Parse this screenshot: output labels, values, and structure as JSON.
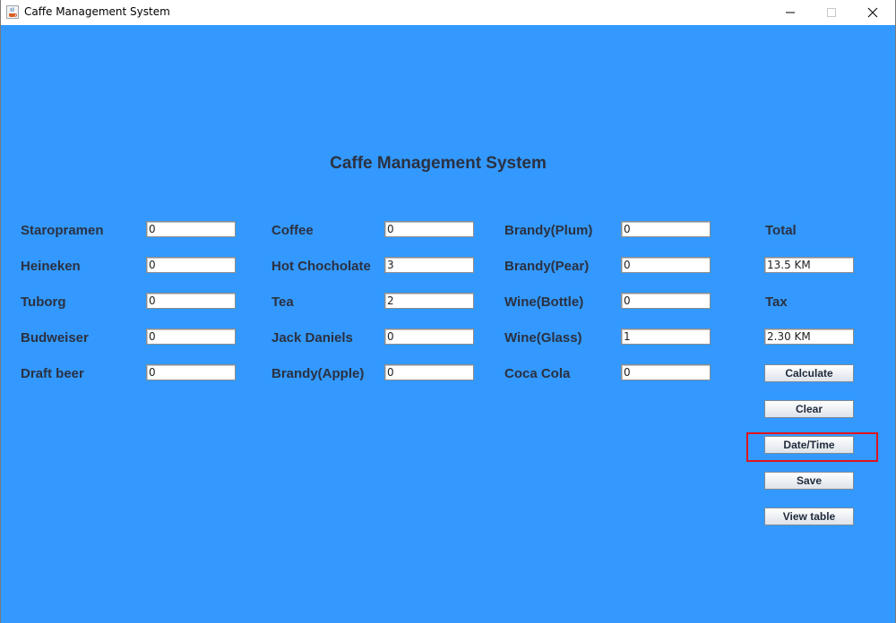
{
  "window": {
    "title": "Caffe Management System"
  },
  "heading": "Caffe Management System",
  "items": [
    {
      "label": "Staropramen",
      "value": "0"
    },
    {
      "label": "Heineken",
      "value": "0"
    },
    {
      "label": "Tuborg",
      "value": "0"
    },
    {
      "label": "Budweiser",
      "value": "0"
    },
    {
      "label": "Draft beer",
      "value": "0"
    },
    {
      "label": "Coffee",
      "value": "0"
    },
    {
      "label": "Hot Chocholate",
      "value": "3"
    },
    {
      "label": "Tea",
      "value": "2"
    },
    {
      "label": "Jack Daniels",
      "value": "0"
    },
    {
      "label": "Brandy(Apple)",
      "value": "0"
    },
    {
      "label": "Brandy(Plum)",
      "value": "0"
    },
    {
      "label": "Brandy(Pear)",
      "value": "0"
    },
    {
      "label": "Wine(Bottle)",
      "value": "0"
    },
    {
      "label": "Wine(Glass)",
      "value": "1"
    },
    {
      "label": "Coca Cola",
      "value": "0"
    }
  ],
  "summary": {
    "total_label": "Total",
    "total_value": "13.5 KM",
    "tax_label": "Tax",
    "tax_value": "2.30 KM"
  },
  "buttons": {
    "calculate": "Calculate",
    "clear": "Clear",
    "datetime": "Date/Time",
    "save": "Save",
    "view_table": "View table"
  },
  "colors": {
    "background": "#3399ff",
    "label": "#2b3140",
    "highlight": "#e0141e"
  },
  "icons": {
    "app": "java-cup-icon",
    "minimize": "minimize-icon",
    "maximize": "maximize-icon",
    "close": "close-icon"
  }
}
